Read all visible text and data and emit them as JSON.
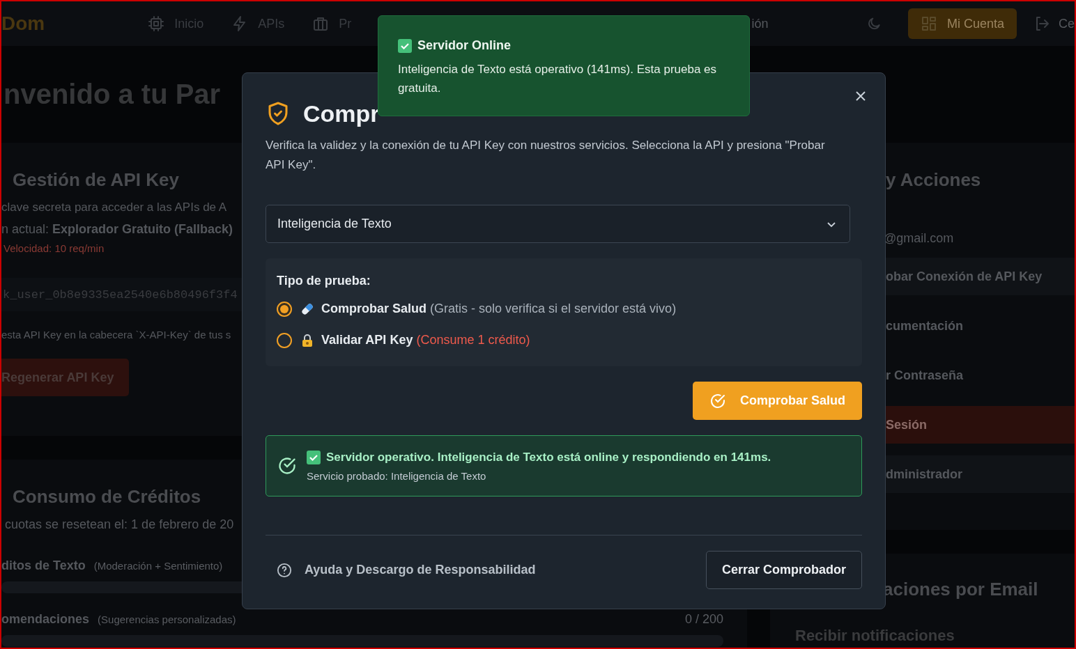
{
  "nav": {
    "logo": "Dom",
    "items": [
      {
        "label": "Inicio"
      },
      {
        "label": "APIs"
      },
      {
        "label": "Pr"
      }
    ],
    "tail": "ión",
    "account_button": "Mi Cuenta",
    "logout": "Ce"
  },
  "hero": {
    "title": "nvenido a tu Par"
  },
  "api_key_card": {
    "title": "Gestión de API Key",
    "description": "clave secreta para acceder a las APIs de A",
    "plan": "n actual: **Explorador Gratuito (Fallback)**",
    "rate": "Velocidad: 10 req/min",
    "key": "k_user_0b8e9335ea2540e6b80496f3f4",
    "hint": "esta API Key en la cabecera `X-API-Key` de tus s",
    "button": "Regenerar API Key"
  },
  "credits_card": {
    "title": "Consumo de Créditos",
    "reset": "cuotas se resetean el: 1 de febrero de 20",
    "rows": [
      {
        "name": "ditos de Texto",
        "note": "(Moderación + Sentimiento)"
      },
      {
        "name": "omendaciones",
        "note": "(Sugerencias personalizadas)",
        "count": "0 / 200"
      }
    ]
  },
  "actions_card": {
    "title": "y Acciones",
    "email": "@gmail.com",
    "items": [
      {
        "label": "obar Conexión de API Key",
        "kind": "shaded"
      },
      {
        "label": "cumentación",
        "kind": "plain"
      },
      {
        "label": "r Contraseña",
        "kind": "plain"
      },
      {
        "label": "Sesión",
        "kind": "danger"
      },
      {
        "label": "dministrador",
        "kind": "shaded"
      }
    ]
  },
  "email_card": {
    "title": "aciones por Email",
    "option": "Recibir notificaciones"
  },
  "modal": {
    "title": "Compr",
    "description": "Verifica la validez y la conexión de tu API Key con nuestros servicios. Selecciona la API y presiona \"Probar API Key\".",
    "select": {
      "value": "Inteligencia de Texto"
    },
    "test_type": {
      "label": "Tipo de prueba:",
      "options": [
        {
          "label": "Comprobar Salud",
          "note": "(Gratis - solo verifica si el servidor está vivo)",
          "kind": "free",
          "selected": true
        },
        {
          "label": "Validar API Key",
          "note": "(Consume 1 crédito)",
          "kind": "paid",
          "selected": false
        }
      ]
    },
    "action_button": "Comprobar Salud",
    "result": {
      "message": "Servidor operativo. Inteligencia de Texto está online y respondiendo en 141ms.",
      "detail": "Servicio probado: Inteligencia de Texto"
    },
    "help_link": "Ayuda y Descargo de Responsabilidad",
    "close_button": "Cerrar Comprobador"
  },
  "toast": {
    "title": "Servidor Online",
    "message": "Inteligencia de Texto está operativo (141ms). Esta prueba es gratuita."
  }
}
